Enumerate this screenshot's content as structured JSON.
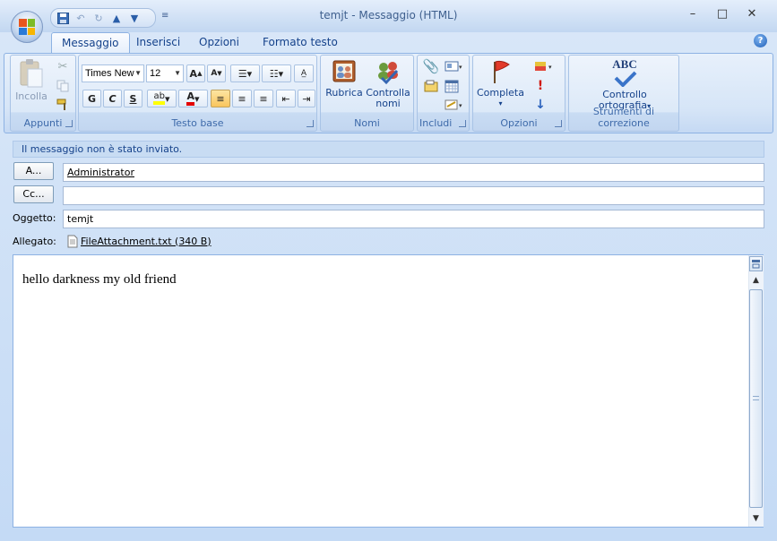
{
  "window": {
    "title": "temjt - Messaggio (HTML)",
    "controls": {
      "minimize": "–",
      "maximize": "□",
      "close": "✕"
    }
  },
  "qat": {
    "save_icon": "save-icon",
    "undo_icon": "undo-icon",
    "redo_icon": "redo-icon",
    "up_icon": "arrow-up-icon",
    "down_icon": "arrow-down-icon",
    "more": "≡"
  },
  "tabs": [
    "Messaggio",
    "Inserisci",
    "Opzioni",
    "Formato testo"
  ],
  "active_tab": "Messaggio",
  "help": "?",
  "ribbon": {
    "appunti": {
      "label": "Appunti",
      "paste": "Incolla"
    },
    "testo_base": {
      "label": "Testo base",
      "font": "Times New",
      "size": "12",
      "bold": "G",
      "italic": "C",
      "underline": "S"
    },
    "nomi": {
      "label": "Nomi",
      "rubrica": "Rubrica",
      "controlla_line1": "Controlla",
      "controlla_line2": "nomi"
    },
    "includi": {
      "label": "Includi"
    },
    "opzioni": {
      "label": "Opzioni",
      "completa": "Completa"
    },
    "strumenti": {
      "label": "Strumenti di correzione",
      "controllo_line1": "Controllo",
      "controllo_line2": "ortografia",
      "abc": "ABC"
    }
  },
  "message": {
    "info": "Il messaggio non è stato inviato.",
    "to_button": "A...",
    "to_value": "Administrator",
    "cc_button": "Cc...",
    "cc_value": "",
    "subject_label": "Oggetto:",
    "subject_value": "temjt",
    "attach_label": "Allegato:",
    "attachment": "FileAttachment.txt (340 B)",
    "body": "hello darkness my old friend"
  },
  "colors": {
    "accent": "#15428b",
    "highlight": "#ffff00",
    "font_color": "#e30000",
    "ribbon": "#dce9f8"
  }
}
